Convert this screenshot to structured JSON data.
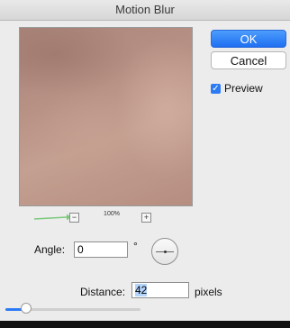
{
  "window": {
    "title": "Motion Blur"
  },
  "preview": {
    "zoom_level": "100%",
    "zoom_out_label": "−",
    "zoom_in_label": "+"
  },
  "controls": {
    "angle_label": "Angle:",
    "angle_value": "0",
    "degree_symbol": "°",
    "distance_label": "Distance:",
    "distance_value": "42",
    "units_label": "pixels",
    "distance_slider_fraction": 0.15
  },
  "buttons": {
    "ok_label": "OK",
    "cancel_label": "Cancel"
  },
  "options": {
    "preview_label": "Preview",
    "preview_checked": true,
    "checkmark": "✓"
  },
  "colors": {
    "accent": "#2d7bf4",
    "selection": "#b3d4fc"
  }
}
